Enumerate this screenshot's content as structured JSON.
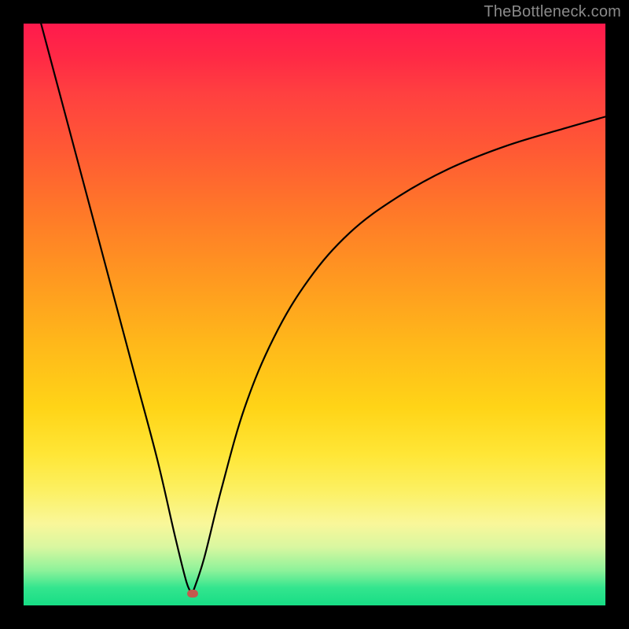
{
  "watermark": "TheBottleneck.com",
  "marker_color": "#c35a4d",
  "chart_data": {
    "type": "line",
    "title": "",
    "xlabel": "",
    "ylabel": "",
    "xlim": [
      0,
      100
    ],
    "ylim": [
      0,
      100
    ],
    "minimum": {
      "x": 29,
      "y": 2
    },
    "series": [
      {
        "name": "left-branch",
        "x": [
          3,
          7,
          11,
          15,
          19,
          23,
          26,
          28,
          29
        ],
        "values": [
          100,
          85,
          70,
          55,
          40,
          25,
          12,
          4,
          2
        ]
      },
      {
        "name": "right-branch",
        "x": [
          29,
          31,
          34,
          38,
          43,
          49,
          56,
          64,
          73,
          83,
          93,
          100
        ],
        "values": [
          2,
          8,
          20,
          34,
          46,
          56,
          64,
          70,
          75,
          79,
          82,
          84
        ]
      }
    ],
    "background_gradient_stops": [
      {
        "pos": 0.0,
        "color": "#ff1a4d"
      },
      {
        "pos": 0.3,
        "color": "#ff7a28"
      },
      {
        "pos": 0.6,
        "color": "#ffd417"
      },
      {
        "pos": 0.85,
        "color": "#f9f79a"
      },
      {
        "pos": 1.0,
        "color": "#17dd85"
      }
    ]
  }
}
